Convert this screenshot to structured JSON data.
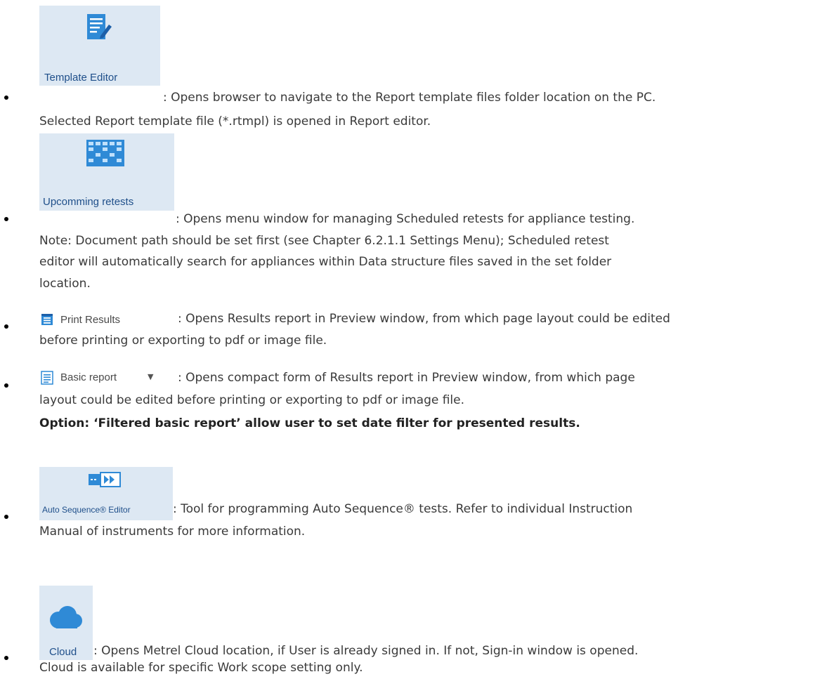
{
  "items": [
    {
      "button_label": "Template Editor",
      "icon": "template-editor-icon",
      "line1": ": Opens browser to navigate to the Report template files folder location on the PC.",
      "line2": "Selected Report template file (*.rtmpl) is opened in Report editor."
    },
    {
      "button_label": "Upcomming retests",
      "icon": "calendar-grid-icon",
      "line1": ": Opens menu window for managing Scheduled retests for appliance testing.",
      "line2": "Note: Document path should be set first (see Chapter 6.2.1.1 Settings Menu); Scheduled retest",
      "line3": "editor will automatically search for appliances within Data structure files saved in the set folder",
      "line4": "location."
    },
    {
      "button_label": "Print Results",
      "icon": "print-results-icon",
      "line1": ": Opens Results report in Preview window, from which page layout could be edited",
      "line2": "before printing or exporting to pdf or image file."
    },
    {
      "button_label": "Basic report",
      "icon": "basic-report-icon",
      "line1": ": Opens compact form of Results report in Preview window, from which page",
      "line2": "layout could be edited before printing or exporting to pdf or image file.",
      "option": "Option: ‘Filtered basic report’ allow user to set date filter for presented results."
    },
    {
      "button_label": "Auto Sequence® Editor",
      "icon": "auto-sequence-icon",
      "line1": ": Tool for programming Auto Sequence® tests. Refer to individual Instruction",
      "line2": "Manual of instruments for more information."
    },
    {
      "button_label": "Cloud",
      "icon": "cloud-icon",
      "line1": ": Opens Metrel Cloud location, if User is already signed in. If not, Sign-in window is opened.",
      "line2": "Cloud is available for specific Work scope setting only."
    }
  ],
  "colors": {
    "button_bg": "#dde8f3",
    "icon_blue": "#2f8ad6",
    "label_blue": "#1f4f8a"
  }
}
